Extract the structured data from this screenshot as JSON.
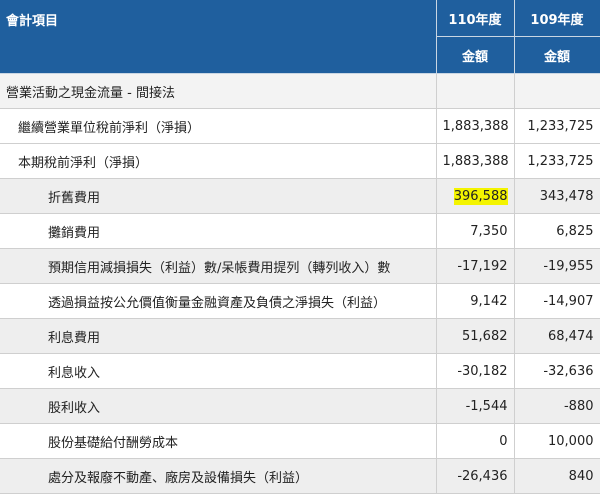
{
  "header": {
    "account_label": "會計項目",
    "col_2021": "110年度",
    "col_2020": "109年度",
    "amount_label": "金額"
  },
  "rows": [
    {
      "label": "營業活動之現金流量 - 間接法",
      "y110": "",
      "y109": ""
    },
    {
      "label": "繼續營業單位稅前淨利（淨損）",
      "y110": "1,883,388",
      "y109": "1,233,725"
    },
    {
      "label": "本期稅前淨利（淨損）",
      "y110": "1,883,388",
      "y109": "1,233,725"
    },
    {
      "label": "折舊費用",
      "y110": "396,588",
      "y109": "343,478"
    },
    {
      "label": "攤銷費用",
      "y110": "7,350",
      "y109": "6,825"
    },
    {
      "label": "預期信用減損損失（利益）數∕呆帳費用提列（轉列收入）數",
      "y110": "-17,192",
      "y109": "-19,955"
    },
    {
      "label": "透過損益按公允價值衡量金融資產及負債之淨損失（利益）",
      "y110": "9,142",
      "y109": "-14,907"
    },
    {
      "label": "利息費用",
      "y110": "51,682",
      "y109": "68,474"
    },
    {
      "label": "利息收入",
      "y110": "-30,182",
      "y109": "-32,636"
    },
    {
      "label": "股利收入",
      "y110": "-1,544",
      "y109": "-880"
    },
    {
      "label": "股份基礎給付酬勞成本",
      "y110": "0",
      "y109": "10,000"
    },
    {
      "label": "處分及報廢不動產、廠房及設備損失（利益）",
      "y110": "-26,436",
      "y109": "840"
    }
  ],
  "highlight_color": "#f4f400",
  "header_color": "#1f5f9e"
}
